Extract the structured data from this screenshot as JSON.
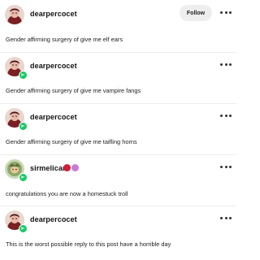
{
  "posts": [
    {
      "username": "dearpercocet",
      "follow_label": "Follow",
      "show_follow": true,
      "show_badge": false,
      "emojis": [],
      "text": "Gender affirming surgery of give me elf ears"
    },
    {
      "username": "dearpercocet",
      "show_follow": false,
      "show_badge": true,
      "emojis": [],
      "text": "Gender affirming surgery of give me vampire fangs"
    },
    {
      "username": "dearpercocet",
      "show_follow": false,
      "show_badge": true,
      "emojis": [],
      "text": "Gender affirming surgery of give me taifling horns"
    },
    {
      "username": "sirmelican",
      "show_follow": false,
      "show_badge": true,
      "emojis": [
        "red-circle-emoji",
        "purple-sticker-emoji"
      ],
      "text": "congratulations you are now a homestuck troll"
    },
    {
      "username": "dearpercocet",
      "show_follow": false,
      "show_badge": true,
      "emojis": [],
      "text": "This is the worst possible reply to this post have a horrible day"
    }
  ],
  "colors": {
    "badge": "#17c964",
    "follow_bg": "#eeeeee",
    "divider": "#ececec"
  }
}
